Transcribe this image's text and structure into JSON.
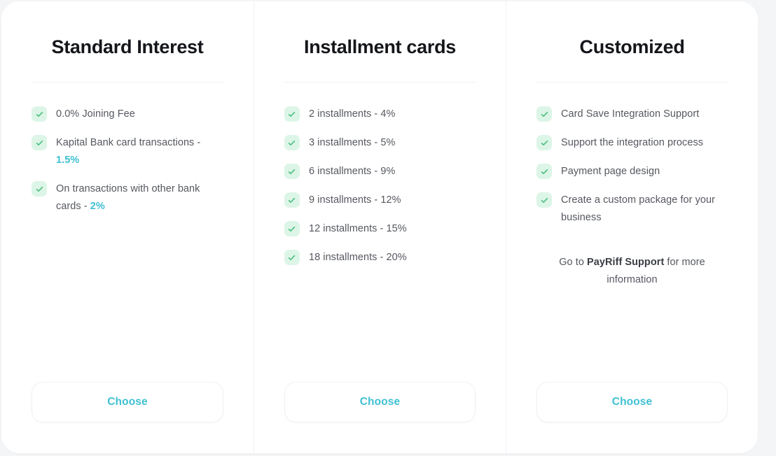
{
  "theme": {
    "page_background": "#f4f5f7",
    "card_background": "#ffffff",
    "accent": "#3fc0d2",
    "check_green": "#4cbe7e",
    "check_badge_background": "#dcf5e7",
    "title_color": "#14161a",
    "body_text_color": "#55585f"
  },
  "plans": [
    {
      "id": "standard-interest",
      "title": "Standard Interest",
      "features": [
        {
          "text": "0.0% Joining Fee",
          "accent": ""
        },
        {
          "text": "Kapital Bank card transactions - ",
          "accent": "1.5%"
        },
        {
          "text": "On transactions with other bank cards - ",
          "accent": "2%"
        }
      ],
      "note": null,
      "button_label": "Choose"
    },
    {
      "id": "installment-cards",
      "title": "Installment cards",
      "features": [
        {
          "text": "2 installments - 4%",
          "accent": ""
        },
        {
          "text": "3 installments - 5%",
          "accent": ""
        },
        {
          "text": "6 installments - 9%",
          "accent": ""
        },
        {
          "text": "9 installments - 12%",
          "accent": ""
        },
        {
          "text": "12 installments - 15%",
          "accent": ""
        },
        {
          "text": "18 installments - 20%",
          "accent": ""
        }
      ],
      "note": null,
      "button_label": "Choose"
    },
    {
      "id": "customized",
      "title": "Customized",
      "features": [
        {
          "text": "Card Save Integration Support",
          "accent": ""
        },
        {
          "text": "Support the integration process",
          "accent": ""
        },
        {
          "text": "Payment page design",
          "accent": ""
        },
        {
          "text": "Create a custom package for your business",
          "accent": ""
        }
      ],
      "note": {
        "prefix": "Go to ",
        "strong": "PayRiff Support",
        "suffix": " for more information"
      },
      "button_label": "Choose"
    }
  ],
  "icons": {
    "check": "check-icon"
  }
}
